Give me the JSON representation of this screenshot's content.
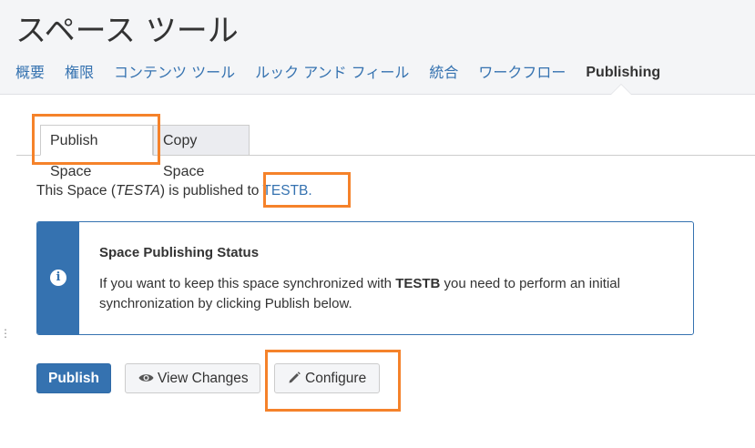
{
  "header": {
    "title": "スペース ツール"
  },
  "nav": {
    "items": [
      {
        "label": "概要",
        "active": false
      },
      {
        "label": "権限",
        "active": false
      },
      {
        "label": "コンテンツ ツール",
        "active": false
      },
      {
        "label": "ルック アンド フィール",
        "active": false
      },
      {
        "label": "統合",
        "active": false
      },
      {
        "label": "ワークフロー",
        "active": false
      },
      {
        "label": "Publishing",
        "active": true
      }
    ]
  },
  "tabs": {
    "publish_space": "Publish Space",
    "copy_space": "Copy Space"
  },
  "publish_info": {
    "prefix": "This Space (",
    "space_key": "TESTA",
    "middle": ") is published to ",
    "target_link": "TESTB."
  },
  "status": {
    "title": "Space Publishing Status",
    "body_prefix": "If you want to keep this space synchronized with ",
    "body_target": "TESTB",
    "body_suffix": " you need to perform an initial synchronization by clicking Publish below.",
    "icon": "info-icon"
  },
  "buttons": {
    "publish": "Publish",
    "view_changes": "View Changes",
    "configure": "Configure"
  },
  "colors": {
    "accent": "#3572b0",
    "highlight": "#f5822a",
    "header_bg": "#f4f5f7"
  }
}
